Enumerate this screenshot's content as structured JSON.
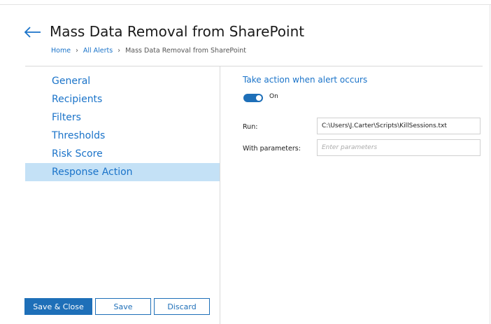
{
  "header": {
    "title": "Mass Data Removal from SharePoint",
    "breadcrumb": [
      "Home",
      "All Alerts",
      "Mass Data Removal from SharePoint"
    ],
    "breadcrumb_separator": "›"
  },
  "sidebar": {
    "items": [
      {
        "label": "General",
        "active": false
      },
      {
        "label": "Recipients",
        "active": false
      },
      {
        "label": "Filters",
        "active": false
      },
      {
        "label": "Thresholds",
        "active": false
      },
      {
        "label": "Risk Score",
        "active": false
      },
      {
        "label": "Response Action",
        "active": true
      }
    ]
  },
  "footer": {
    "save_close_label": "Save & Close",
    "save_label": "Save",
    "discard_label": "Discard"
  },
  "main": {
    "section_title": "Take action when alert occurs",
    "toggle": {
      "label": "On",
      "state": true
    },
    "run": {
      "label": "Run:",
      "value": "C:\\Users\\J.Carter\\Scripts\\KillSessions.txt"
    },
    "parameters": {
      "label": "With parameters:",
      "value": "",
      "placeholder": "Enter parameters"
    }
  },
  "colors": {
    "accent": "#1e6fb8",
    "link": "#1a73c9",
    "active_bg": "#c4e1f6"
  },
  "icons": {
    "back": "arrow-left-icon"
  }
}
